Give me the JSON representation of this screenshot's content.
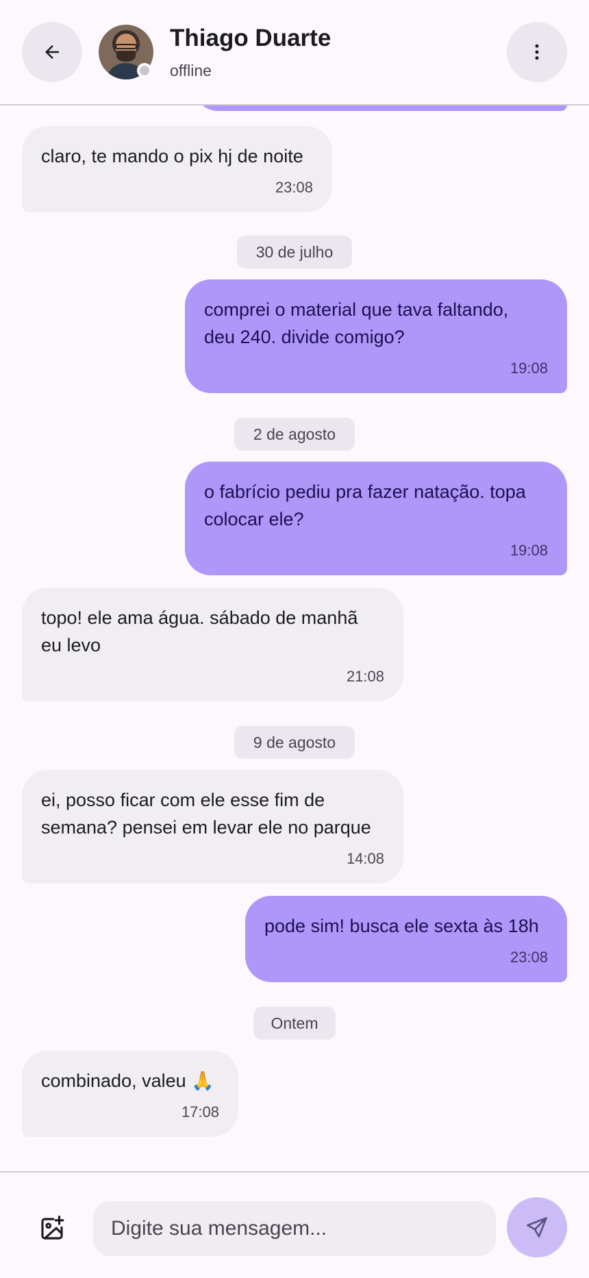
{
  "header": {
    "contact_name": "Thiago Duarte",
    "presence": "offline"
  },
  "messages": [
    {
      "text": "claro, te mando o pix hj de noite",
      "time": "23:08"
    },
    {
      "chip": "30 de julho"
    },
    {
      "text": "comprei o material que tava faltando,\ndeu 240. divide comigo?",
      "time": "19:08"
    },
    {
      "chip": "2 de agosto"
    },
    {
      "text": "o fabrício pediu pra fazer natação. topa\ncolocar ele?",
      "time": "19:08"
    },
    {
      "text": "topo! ele ama água. sábado de manhã\neu levo",
      "time": "21:08"
    },
    {
      "chip": "9 de agosto"
    },
    {
      "text": "ei, posso ficar com ele esse fim de\nsemana? pensei em levar ele no parque",
      "time": "14:08"
    },
    {
      "text": "pode sim! busca ele sexta às 18h",
      "time": "23:08"
    },
    {
      "chip": "Ontem"
    },
    {
      "text": "combinado, valeu 🙏",
      "time": "17:08"
    }
  ],
  "composer": {
    "placeholder": "Digite sua mensagem..."
  },
  "icons": {
    "back": "arrow-left-icon",
    "menu": "more-vert-icon",
    "attach": "add-photo-icon",
    "send": "send-icon"
  },
  "colors": {
    "outgoing_bubble": "#ae97f8",
    "incoming_bubble": "#f1eef3",
    "send_button": "#cbbcf8"
  }
}
